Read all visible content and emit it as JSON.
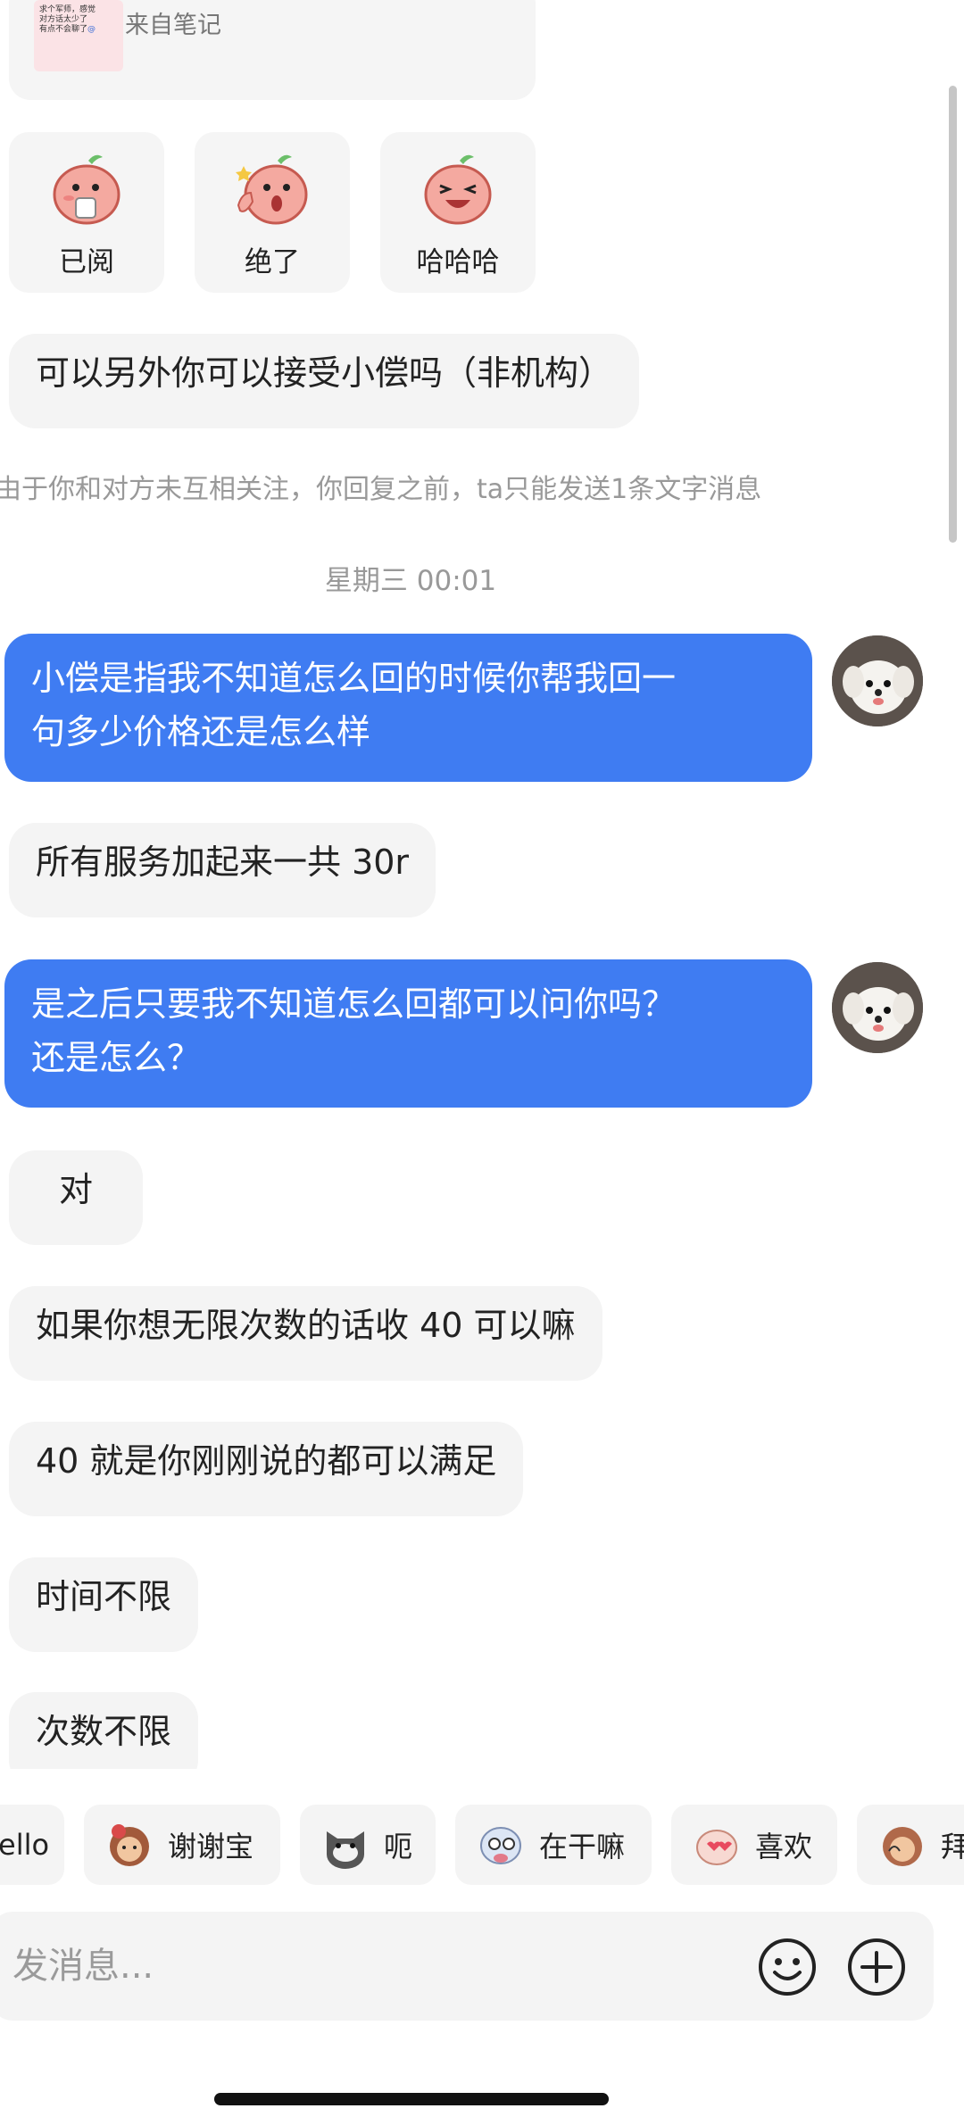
{
  "note_card": {
    "thumb_lines": [
      "求个军师，感觉",
      "对方话太少了",
      "有点不会聊了"
    ],
    "thumb_link": "@",
    "source_label": "来自笔记"
  },
  "stickers": [
    {
      "label": "已阅",
      "icon": "peach-drinking-icon"
    },
    {
      "label": "绝了",
      "icon": "peach-thumbs-up-icon"
    },
    {
      "label": "哈哈哈",
      "icon": "peach-laughing-icon"
    }
  ],
  "messages": {
    "m1": "可以另外你可以接受小偿吗（非机构）",
    "system_note": "由于你和对方未互相关注，你回复之前，ta只能发送1条文字消息",
    "timestamp": "星期三 00:01",
    "m2_line1": "小偿是指我不知道怎么回的时候你帮我回一",
    "m2_line2": "句多少价格还是怎么样",
    "m3": "所有服务加起来一共 30r",
    "m4_line1": "是之后只要我不知道怎么回都可以问你吗？",
    "m4_line2": "还是怎么？",
    "m5": "对",
    "m6": "如果你想无限次数的话收 40 可以嘛",
    "m7": "40 就是你刚刚说的都可以满足",
    "m8": "时间不限",
    "m9": "次数不限"
  },
  "quick_replies": [
    "ello",
    "谢谢宝",
    "呃",
    "在干嘛",
    "喜欢",
    "拜"
  ],
  "composer": {
    "placeholder": "发消息...",
    "emoji_icon": "smiley-icon",
    "add_icon": "plus-circle-icon"
  },
  "colors": {
    "outgoing_bubble": "#3F7CF2",
    "incoming_bubble": "#F4F4F4",
    "muted_text": "#999999",
    "background": "#FFFFFF"
  }
}
